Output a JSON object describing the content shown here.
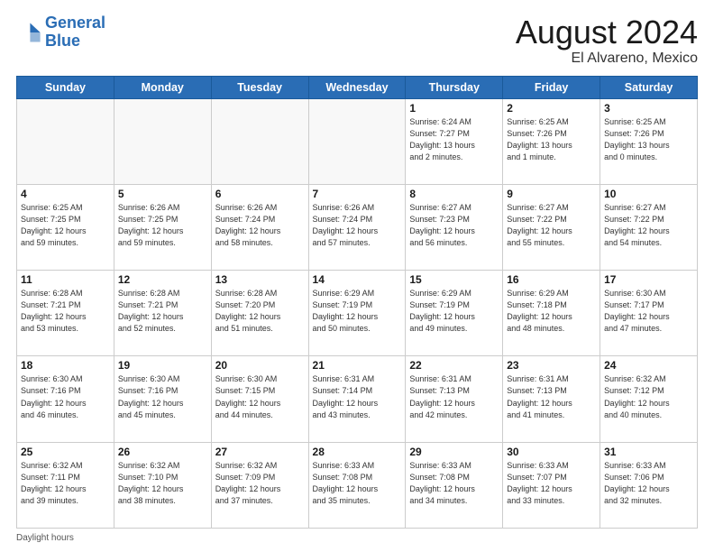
{
  "header": {
    "logo_line1": "General",
    "logo_line2": "Blue",
    "main_title": "August 2024",
    "sub_title": "El Alvareno, Mexico"
  },
  "footer": {
    "note": "Daylight hours"
  },
  "days_of_week": [
    "Sunday",
    "Monday",
    "Tuesday",
    "Wednesday",
    "Thursday",
    "Friday",
    "Saturday"
  ],
  "weeks": [
    [
      {
        "num": "",
        "info": ""
      },
      {
        "num": "",
        "info": ""
      },
      {
        "num": "",
        "info": ""
      },
      {
        "num": "",
        "info": ""
      },
      {
        "num": "1",
        "info": "Sunrise: 6:24 AM\nSunset: 7:27 PM\nDaylight: 13 hours\nand 2 minutes."
      },
      {
        "num": "2",
        "info": "Sunrise: 6:25 AM\nSunset: 7:26 PM\nDaylight: 13 hours\nand 1 minute."
      },
      {
        "num": "3",
        "info": "Sunrise: 6:25 AM\nSunset: 7:26 PM\nDaylight: 13 hours\nand 0 minutes."
      }
    ],
    [
      {
        "num": "4",
        "info": "Sunrise: 6:25 AM\nSunset: 7:25 PM\nDaylight: 12 hours\nand 59 minutes."
      },
      {
        "num": "5",
        "info": "Sunrise: 6:26 AM\nSunset: 7:25 PM\nDaylight: 12 hours\nand 59 minutes."
      },
      {
        "num": "6",
        "info": "Sunrise: 6:26 AM\nSunset: 7:24 PM\nDaylight: 12 hours\nand 58 minutes."
      },
      {
        "num": "7",
        "info": "Sunrise: 6:26 AM\nSunset: 7:24 PM\nDaylight: 12 hours\nand 57 minutes."
      },
      {
        "num": "8",
        "info": "Sunrise: 6:27 AM\nSunset: 7:23 PM\nDaylight: 12 hours\nand 56 minutes."
      },
      {
        "num": "9",
        "info": "Sunrise: 6:27 AM\nSunset: 7:22 PM\nDaylight: 12 hours\nand 55 minutes."
      },
      {
        "num": "10",
        "info": "Sunrise: 6:27 AM\nSunset: 7:22 PM\nDaylight: 12 hours\nand 54 minutes."
      }
    ],
    [
      {
        "num": "11",
        "info": "Sunrise: 6:28 AM\nSunset: 7:21 PM\nDaylight: 12 hours\nand 53 minutes."
      },
      {
        "num": "12",
        "info": "Sunrise: 6:28 AM\nSunset: 7:21 PM\nDaylight: 12 hours\nand 52 minutes."
      },
      {
        "num": "13",
        "info": "Sunrise: 6:28 AM\nSunset: 7:20 PM\nDaylight: 12 hours\nand 51 minutes."
      },
      {
        "num": "14",
        "info": "Sunrise: 6:29 AM\nSunset: 7:19 PM\nDaylight: 12 hours\nand 50 minutes."
      },
      {
        "num": "15",
        "info": "Sunrise: 6:29 AM\nSunset: 7:19 PM\nDaylight: 12 hours\nand 49 minutes."
      },
      {
        "num": "16",
        "info": "Sunrise: 6:29 AM\nSunset: 7:18 PM\nDaylight: 12 hours\nand 48 minutes."
      },
      {
        "num": "17",
        "info": "Sunrise: 6:30 AM\nSunset: 7:17 PM\nDaylight: 12 hours\nand 47 minutes."
      }
    ],
    [
      {
        "num": "18",
        "info": "Sunrise: 6:30 AM\nSunset: 7:16 PM\nDaylight: 12 hours\nand 46 minutes."
      },
      {
        "num": "19",
        "info": "Sunrise: 6:30 AM\nSunset: 7:16 PM\nDaylight: 12 hours\nand 45 minutes."
      },
      {
        "num": "20",
        "info": "Sunrise: 6:30 AM\nSunset: 7:15 PM\nDaylight: 12 hours\nand 44 minutes."
      },
      {
        "num": "21",
        "info": "Sunrise: 6:31 AM\nSunset: 7:14 PM\nDaylight: 12 hours\nand 43 minutes."
      },
      {
        "num": "22",
        "info": "Sunrise: 6:31 AM\nSunset: 7:13 PM\nDaylight: 12 hours\nand 42 minutes."
      },
      {
        "num": "23",
        "info": "Sunrise: 6:31 AM\nSunset: 7:13 PM\nDaylight: 12 hours\nand 41 minutes."
      },
      {
        "num": "24",
        "info": "Sunrise: 6:32 AM\nSunset: 7:12 PM\nDaylight: 12 hours\nand 40 minutes."
      }
    ],
    [
      {
        "num": "25",
        "info": "Sunrise: 6:32 AM\nSunset: 7:11 PM\nDaylight: 12 hours\nand 39 minutes."
      },
      {
        "num": "26",
        "info": "Sunrise: 6:32 AM\nSunset: 7:10 PM\nDaylight: 12 hours\nand 38 minutes."
      },
      {
        "num": "27",
        "info": "Sunrise: 6:32 AM\nSunset: 7:09 PM\nDaylight: 12 hours\nand 37 minutes."
      },
      {
        "num": "28",
        "info": "Sunrise: 6:33 AM\nSunset: 7:08 PM\nDaylight: 12 hours\nand 35 minutes."
      },
      {
        "num": "29",
        "info": "Sunrise: 6:33 AM\nSunset: 7:08 PM\nDaylight: 12 hours\nand 34 minutes."
      },
      {
        "num": "30",
        "info": "Sunrise: 6:33 AM\nSunset: 7:07 PM\nDaylight: 12 hours\nand 33 minutes."
      },
      {
        "num": "31",
        "info": "Sunrise: 6:33 AM\nSunset: 7:06 PM\nDaylight: 12 hours\nand 32 minutes."
      }
    ]
  ]
}
